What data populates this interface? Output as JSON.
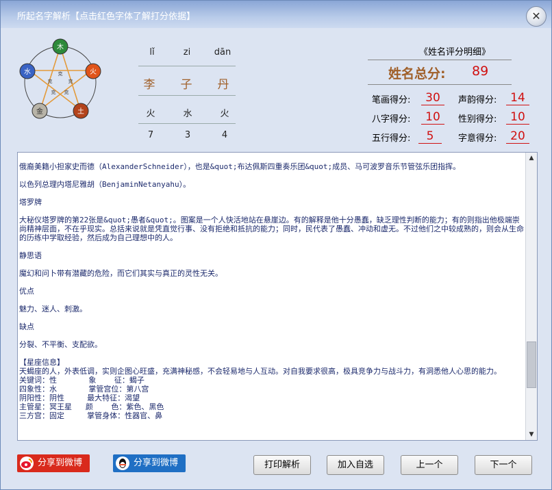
{
  "window": {
    "title": "所起名字解析【点击红色字体了解打分依据】",
    "close_label": "✕"
  },
  "wuxing": {
    "labels": [
      "木",
      "火",
      "土",
      "金",
      "水"
    ],
    "center": [
      "克",
      "克",
      "克",
      "克",
      "克"
    ]
  },
  "name": {
    "pinyin": [
      "lǐ",
      "zi",
      "dān"
    ],
    "chars": [
      "李",
      "子",
      "丹"
    ],
    "elements": [
      "火",
      "水",
      "火"
    ],
    "strokes": [
      "7",
      "3",
      "4"
    ]
  },
  "scores": {
    "title": "《姓名评分明细》",
    "total_label": "姓名总分:",
    "total_value": "89",
    "items": [
      {
        "label": "笔画得分:",
        "value": "30"
      },
      {
        "label": "声韵得分:",
        "value": "14"
      },
      {
        "label": "八字得分:",
        "value": "10"
      },
      {
        "label": "性别得分:",
        "value": "10"
      },
      {
        "label": "五行得分:",
        "value": "5"
      },
      {
        "label": "字意得分:",
        "value": "20"
      }
    ]
  },
  "content": {
    "lines": [
      "俄裔美籍小担家史而德（AlexanderSchneider），也是&quot;布达佩斯四重奏乐团&quot;成员、马可波罗音乐节管弦乐团指挥。",
      "",
      "以色列总理内塔尼雅胡（BenjaminNetanyahu）。",
      "",
      "塔罗牌",
      "",
      "大秘仪塔罗牌的第22张是&quot;愚者&quot;。图案是一个人快活地站在悬崖边。有的解释是他十分愚蠢，缺乏理性判断的能力；有的则指出他极端崇尚精神层面，不在乎现实。总括来说就是凭直觉行事、没有拒绝和抵抗的能力；同时，民代表了愚蠢、冲动和虚无。不过他们之中较成熟的，则会从生命的历练中学取经验，然后成为自己理想中的人。",
      "",
      "静思语",
      "",
      "魔幻和问卜带有潜藏的危险，而它们其实与真正的灵性无关。",
      "",
      "优点",
      "",
      "魅力、迷人、刺激。",
      "",
      "缺点",
      "",
      "分裂、不平衡、支配欲。",
      "",
      "【星座信息】",
      "天蝎座的人，外表低调，实则企图心旺盛，充满神秘感，不会轻易地与人互动。对自我要求很高，极具竞争力与战斗力，有洞悉他人心思的能力。",
      "关键词：性       象    征：蝎子",
      "四象性：水       掌管宫位：第八宫",
      "阴阳性：阴性     最大特征：渴望",
      "主管星：冥王星   颜    色：紫色、黑色",
      "三方宫：固定     掌管身体：性器官、鼻"
    ]
  },
  "buttons": {
    "share_weibo": "分享到微博",
    "share_qq": "分享到微博",
    "print": "打印解析",
    "add": "加入自选",
    "prev": "上一个",
    "next": "下一个"
  },
  "colors": {
    "accent_red": "#d01010",
    "brown": "#a0602a",
    "title_bar": "#8aa6d6",
    "text_blue": "#1c2a6c"
  }
}
